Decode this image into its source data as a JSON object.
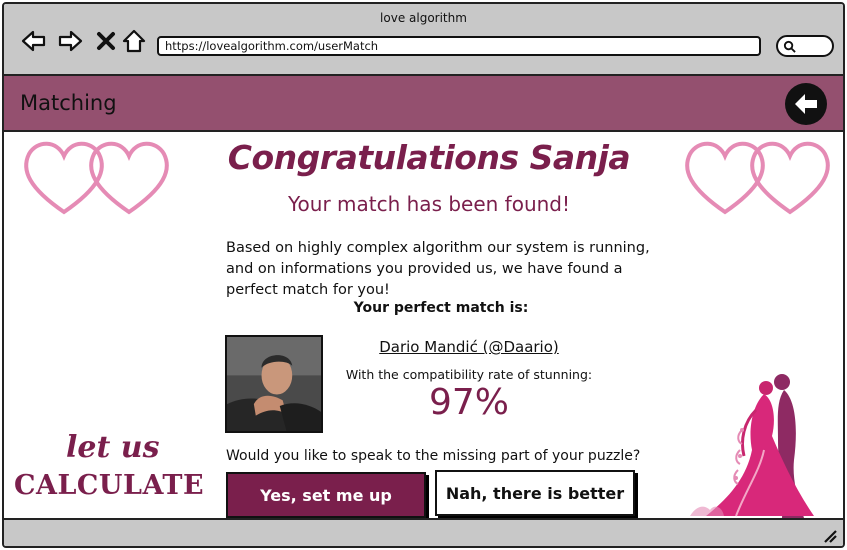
{
  "window": {
    "title": "love algorithm"
  },
  "browser": {
    "url": "https://lovealgorithm.com/userMatch",
    "nav": [
      "back-arrow-icon",
      "forward-arrow-icon",
      "close-icon",
      "home-icon"
    ],
    "search_icon": "search-icon"
  },
  "header": {
    "title": "Matching",
    "back_icon": "back-circle-icon"
  },
  "main": {
    "heading": "Congratulations Sanja",
    "subheading": "Your match has been found!",
    "body_text": "Based on highly complex algorithm our system is running, and on informations you provided us, we have found a perfect match for you!",
    "perfect_label": "Your perfect match is:",
    "match_name": "Dario Mandić (@Daario)",
    "compat_label": "With the compatibility rate of stunning:",
    "compat_value": "97%",
    "question": "Would you like to speak to the missing part of your puzzle?",
    "yes_button": "Yes, set me up",
    "no_button": "Nah, there is better"
  },
  "logo": {
    "top": "let us",
    "bottom": "CALCULATE"
  },
  "colors": {
    "accent": "#7a1f4c",
    "header_bg": "#94506f",
    "chrome_bg": "#c8c8c8",
    "heart_pink": "#e58bb5"
  }
}
